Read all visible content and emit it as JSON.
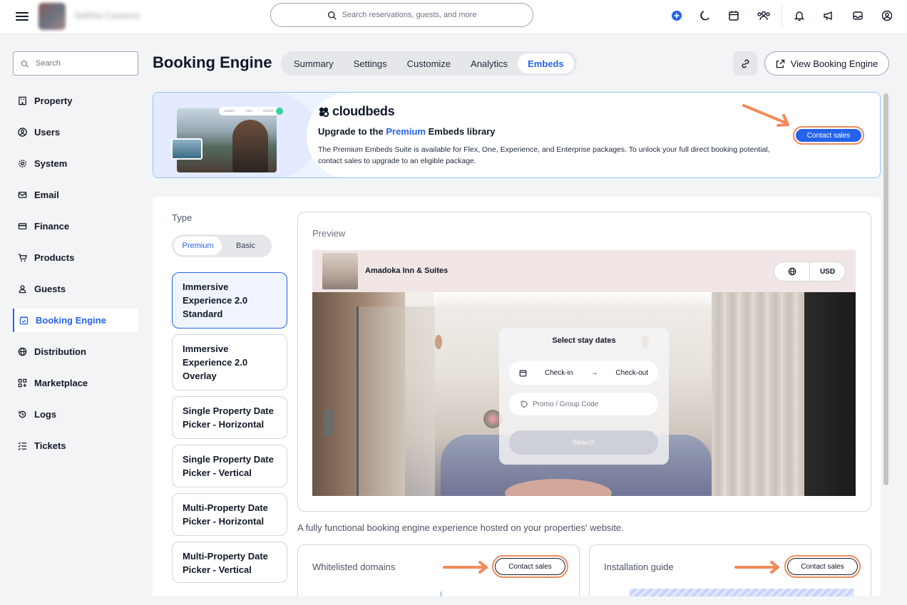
{
  "topbar": {
    "property_name": "Sellina Casasco",
    "search_placeholder": "Search reservations, guests, and more"
  },
  "sidebar": {
    "search_placeholder": "Search",
    "items": [
      {
        "label": "Property",
        "icon": "building-icon"
      },
      {
        "label": "Users",
        "icon": "user-circle-icon"
      },
      {
        "label": "System",
        "icon": "gear-icon"
      },
      {
        "label": "Email",
        "icon": "mail-icon"
      },
      {
        "label": "Finance",
        "icon": "credit-card-icon"
      },
      {
        "label": "Products",
        "icon": "cart-icon"
      },
      {
        "label": "Guests",
        "icon": "person-icon"
      },
      {
        "label": "Booking Engine",
        "icon": "calendar-check-icon",
        "active": true
      },
      {
        "label": "Distribution",
        "icon": "globe-icon"
      },
      {
        "label": "Marketplace",
        "icon": "grid-plus-icon"
      },
      {
        "label": "Logs",
        "icon": "history-icon"
      },
      {
        "label": "Tickets",
        "icon": "checklist-icon"
      }
    ]
  },
  "header": {
    "title": "Booking Engine",
    "tabs": [
      "Summary",
      "Settings",
      "Customize",
      "Analytics",
      "Embeds"
    ],
    "active_tab": "Embeds",
    "view_button": "View Booking Engine"
  },
  "banner": {
    "brand": "cloudbeds",
    "heading_prefix": "Upgrade to the ",
    "heading_highlight": "Premium",
    "heading_suffix": " Embeds library",
    "text": "The Premium Embeds Suite is available for Flex, One, Experience, and Enterprise packages. To unlock your full direct booking potential, contact sales to upgrade to an eligible package.",
    "cta": "Contact sales"
  },
  "embeds": {
    "type_label": "Type",
    "toggle": [
      "Premium",
      "Basic"
    ],
    "toggle_active": "Premium",
    "types": [
      "Immersive Experience 2.0 Standard",
      "Immersive Experience 2.0 Overlay",
      "Single Property Date Picker - Horizontal",
      "Single Property Date Picker - Vertical",
      "Multi-Property Date Picker - Horizontal",
      "Multi-Property Date Picker - Vertical"
    ],
    "preview": {
      "label": "Preview",
      "property": "Amadoka Inn & Suites",
      "currency": "USD",
      "panel_title": "Select stay dates",
      "checkin": "Check-in",
      "checkout": "Check-out",
      "promo_placeholder": "Promo / Group Code",
      "search": "Search"
    },
    "description": "A fully functional booking engine experience hosted on your properties' website.",
    "whitelisted": {
      "title": "Whitelisted domains",
      "cta": "Contact sales"
    },
    "installation": {
      "title": "Installation guide",
      "cta": "Contact sales"
    }
  },
  "colors": {
    "accent": "#2563eb",
    "highlight_ring": "#f28b5c"
  }
}
